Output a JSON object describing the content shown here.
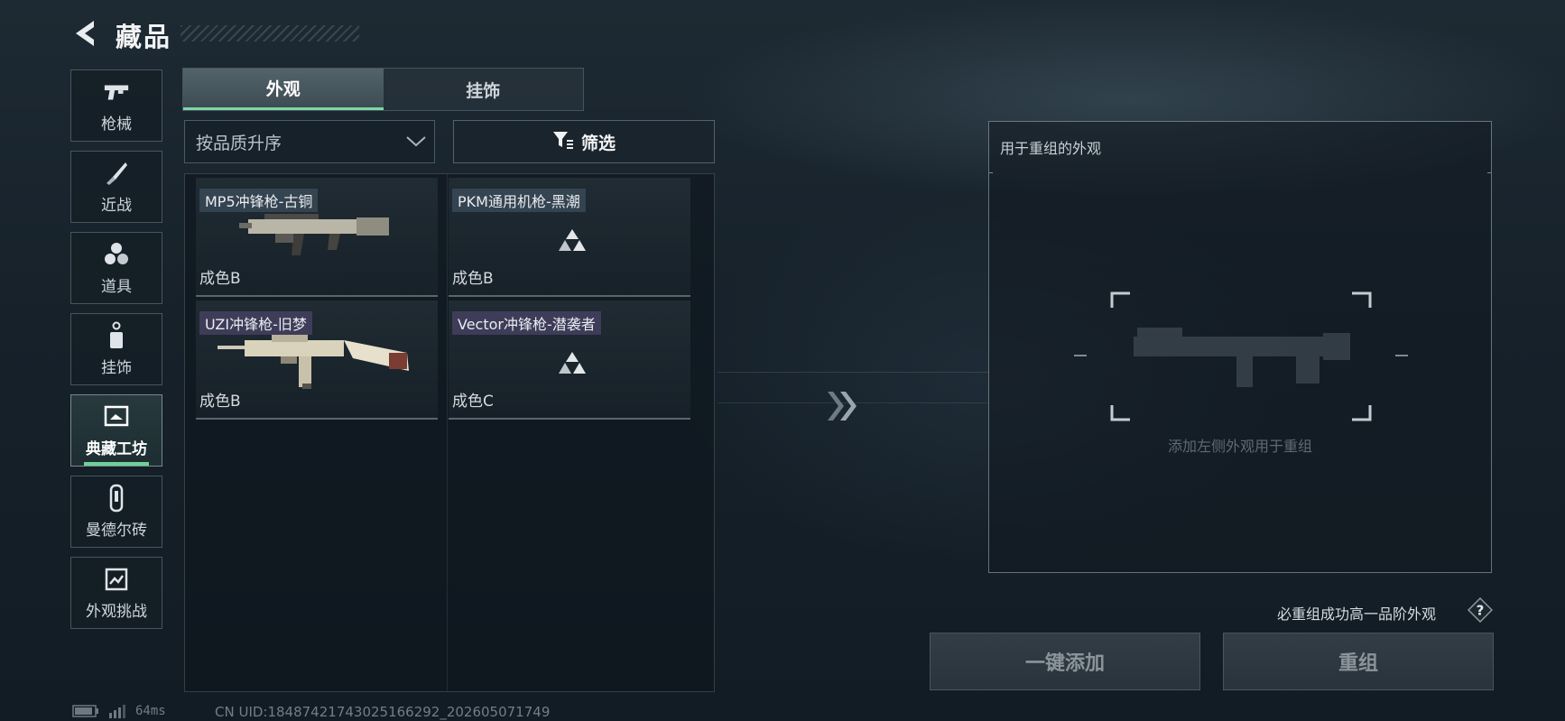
{
  "header": {
    "title": "藏品"
  },
  "sidebar": {
    "items": [
      {
        "label": "枪械",
        "icon": "pistol-icon",
        "active": false
      },
      {
        "label": "近战",
        "icon": "knife-icon",
        "active": false
      },
      {
        "label": "道具",
        "icon": "grenades-icon",
        "active": false
      },
      {
        "label": "挂饰",
        "icon": "charm-icon",
        "active": false
      },
      {
        "label": "典藏工坊",
        "icon": "workshop-icon",
        "active": true
      },
      {
        "label": "曼德尔砖",
        "icon": "brick-icon",
        "active": false
      },
      {
        "label": "外观挑战",
        "icon": "challenge-icon",
        "active": false
      }
    ]
  },
  "tabs": [
    {
      "label": "外观",
      "active": true
    },
    {
      "label": "挂饰",
      "active": false
    }
  ],
  "sort": {
    "value": "按品质升序"
  },
  "filter": {
    "label": "筛选"
  },
  "items": [
    {
      "name": "MP5冲锋枪-古铜",
      "grade": "成色B",
      "has_image": true
    },
    {
      "name": "PKM通用机枪-黑潮",
      "grade": "成色B",
      "has_image": false
    },
    {
      "name": "UZI冲锋枪-旧梦",
      "grade": "成色B",
      "has_image": true
    },
    {
      "name": "Vector冲锋枪-潜袭者",
      "grade": "成色C",
      "has_image": false
    }
  ],
  "recombine": {
    "title": "用于重组的外观",
    "empty_hint": "添加左侧外观用于重组"
  },
  "note": "必重组成功高一品阶外观",
  "buttons": {
    "add_all": "一键添加",
    "recombine": "重组"
  },
  "status": {
    "ping": "64ms",
    "uid": "CN UID:18487421743025166292_202605071749"
  },
  "colors": {
    "accent": "#6fcf9a",
    "purple_tag": "#5f5082",
    "blue_tag": "#506478"
  }
}
